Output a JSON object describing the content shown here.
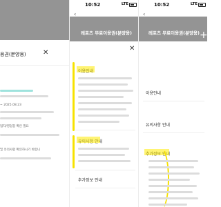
{
  "panel1": {
    "status": {
      "time": "",
      "network": ""
    },
    "header_title": "",
    "sheet_title": "용권(분양용)",
    "highlight_text": "",
    "date_range": "~ 2025.08.23",
    "business_check": "업자/영업장 확인 필요",
    "bottom_text": "및 유의사항 확인하시기 바랍니"
  },
  "panel2": {
    "status": {
      "time": "10:52",
      "network": "LTE"
    },
    "back_icon": "back-arrow",
    "header_title": "",
    "sheet_title": "레포츠 무료이용권(분양용)",
    "close_icon": "close-icon",
    "sections": [
      {
        "label": "이용안내"
      },
      {
        "label": "유의사항 안내"
      },
      {
        "label": "추가정보 안내"
      }
    ]
  },
  "panel3": {
    "status": {
      "time": "10:52",
      "network": "LTE"
    },
    "back_icon": "back-arrow",
    "header_title": "",
    "sheet_title": "레포츠 무료이용권(분양용)",
    "sections": [
      {
        "label": "이용안내"
      },
      {
        "label": "유의사항 안내"
      },
      {
        "label": "추가정보 안내"
      }
    ]
  },
  "colors": {
    "highlight": "#f7e200",
    "accent": "#2bb3a8",
    "overlay": "#6b6b6b"
  }
}
